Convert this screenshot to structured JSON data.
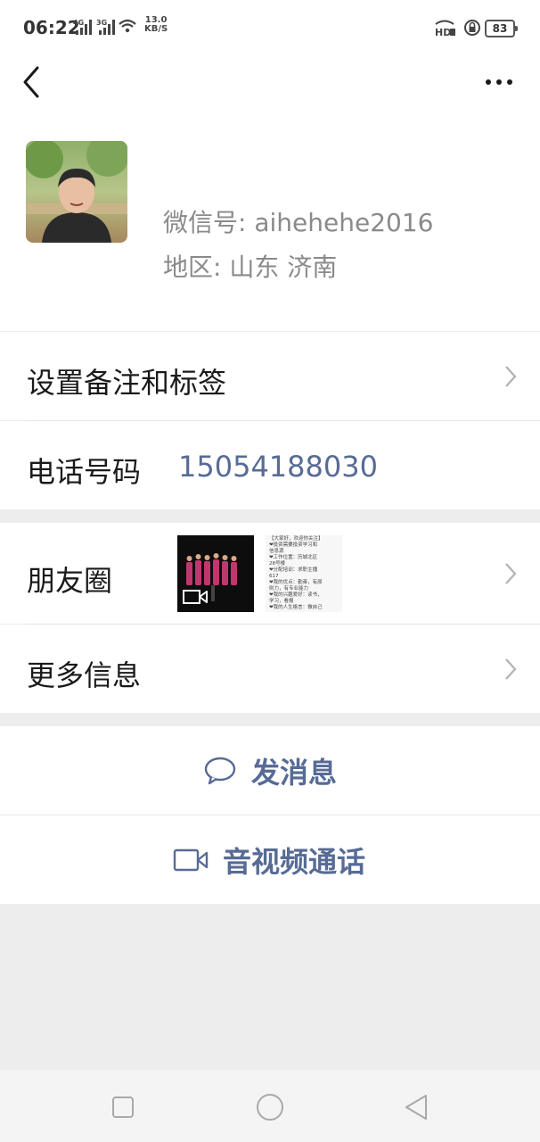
{
  "status_bar": {
    "time": "06:22",
    "net_4g": "4G",
    "net_3g": "3G",
    "speed_value": "13.0",
    "speed_unit": "KB/S",
    "hd_label": "HD",
    "battery": "83"
  },
  "profile": {
    "wechat_id": "微信号: aihehehe2016",
    "region": "地区: 山东 济南"
  },
  "rows": {
    "remarks_label": "设置备注和标签",
    "phone_label": "电话号码",
    "phone_value": "15054188030",
    "moments_label": "朋友圈",
    "more_info_label": "更多信息"
  },
  "moments_text_thumb_lines": [
    "【大家好，欢迎你关注】",
    "❤投资需要投资学习和",
    "信息源",
    "❤工作位置：历城北区",
    "28号楼",
    "❤分配培训：求职主播",
    "617",
    "❤我的优点：勤奋，有原",
    "则力，有专业能力",
    "❤我的兴趣爱好：读书，",
    "学习，看报",
    "❤我的人生格言：做自己"
  ],
  "actions": {
    "message_label": "发消息",
    "call_label": "音视频通话"
  },
  "colors": {
    "link_blue": "#576b95",
    "background": "#ededed"
  },
  "icons": [
    "back-arrow-icon",
    "more-dots-icon",
    "chevron-right-icon",
    "video-icon",
    "chat-bubble-icon",
    "video-camera-icon",
    "square-icon",
    "circle-icon",
    "triangle-back-icon"
  ]
}
